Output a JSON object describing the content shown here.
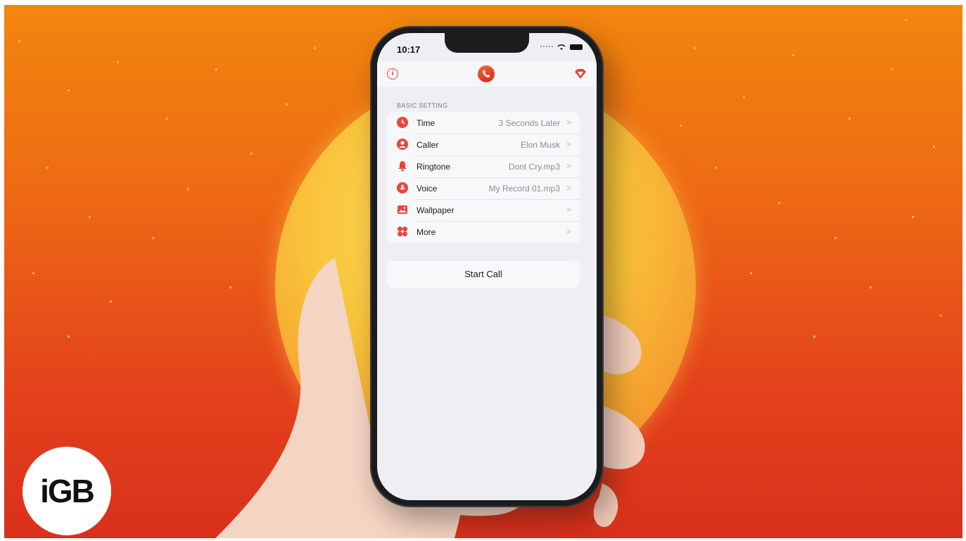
{
  "status_bar": {
    "time": "10:17"
  },
  "nav_bar": {
    "info_icon": "info-icon",
    "logo_icon": "phone-call-icon",
    "premium_icon": "gem-icon"
  },
  "settings": {
    "section_title": "BASIC SETTING",
    "rows": [
      {
        "icon": "clock-icon",
        "label": "Time",
        "value": "3 Seconds Later"
      },
      {
        "icon": "person-icon",
        "label": "Caller",
        "value": "Elon Musk"
      },
      {
        "icon": "bell-icon",
        "label": "Ringtone",
        "value": "Dont Cry.mp3"
      },
      {
        "icon": "microphone-icon",
        "label": "Voice",
        "value": "My Record 01.mp3"
      },
      {
        "icon": "image-icon",
        "label": "Wallpaper",
        "value": ""
      },
      {
        "icon": "grid-icon",
        "label": "More",
        "value": ""
      }
    ]
  },
  "actions": {
    "start_call": "Start Call"
  },
  "brand": {
    "badge_text": "iGB"
  },
  "colors": {
    "accent": "#e8463a",
    "background_top": "#f2870e",
    "background_bottom": "#d9301c"
  }
}
